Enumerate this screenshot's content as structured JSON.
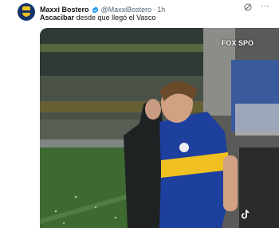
{
  "tweet": {
    "author_name": "Maxxi Bostero",
    "author_handle": "@MaxxiBostero",
    "separator": "·",
    "time": "1h",
    "text_bold": "Ascacibar",
    "text_rest": " desde que llegó el Vasco",
    "more_label": "···"
  },
  "media": {
    "channel_logo": "FOX SPO",
    "watermark_icon": "tiktok-icon",
    "description_colors": {
      "boca_blue": "#1d3f9e",
      "boca_gold": "#f0c020"
    }
  },
  "icons": [
    "verified-badge-icon",
    "grok-icon",
    "more-options-icon"
  ]
}
